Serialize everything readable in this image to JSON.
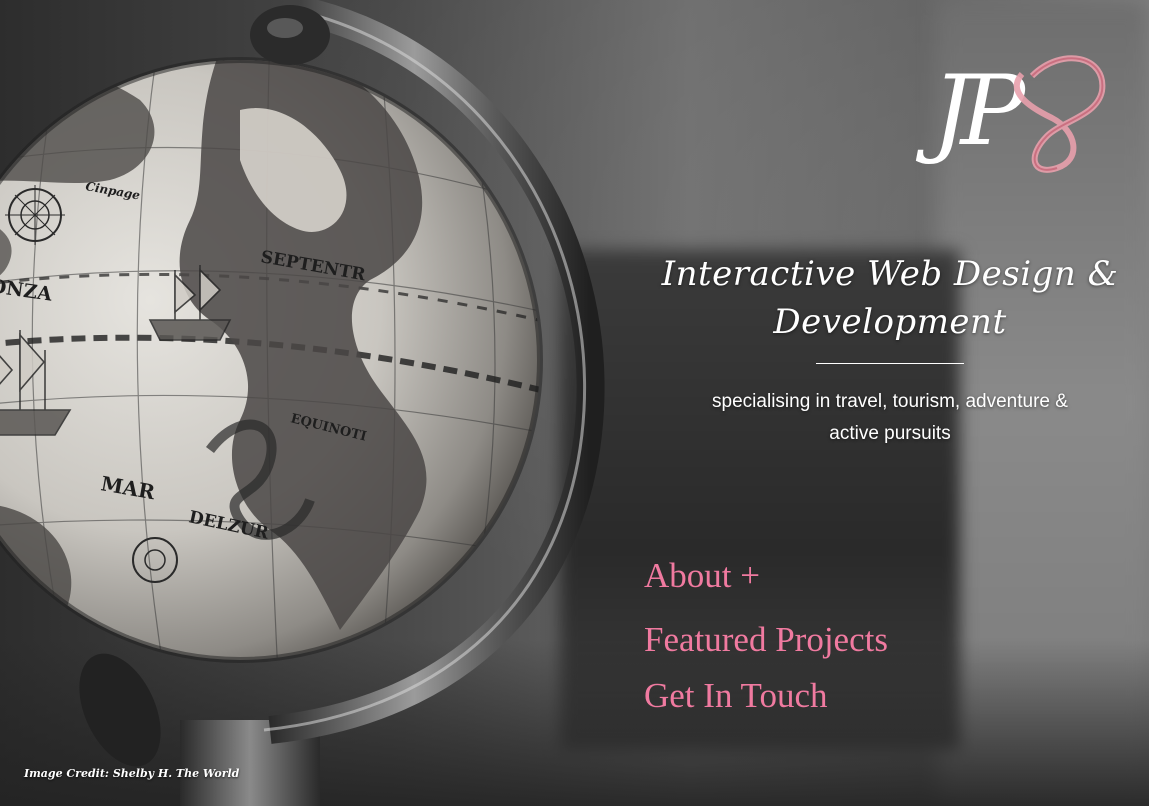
{
  "logo": {
    "text": "JP",
    "accent_color": "#e8a0ac"
  },
  "hero": {
    "title_line1": "Interactive Web Design &",
    "title_line2": "Development",
    "subtitle_line1": "specialising in travel, tourism, adventure &",
    "subtitle_line2": "active pursuits"
  },
  "nav": {
    "about": "About +",
    "projects": "Featured Projects",
    "contact": "Get In Touch",
    "color": "#f07aa0"
  },
  "globe": {
    "labels": [
      "TONZA",
      "MAR",
      "DELZUR",
      "SEPTENTR",
      "EQUINOTI",
      "Cinpage"
    ]
  },
  "credit": "Image Credit: Shelby H. The World"
}
